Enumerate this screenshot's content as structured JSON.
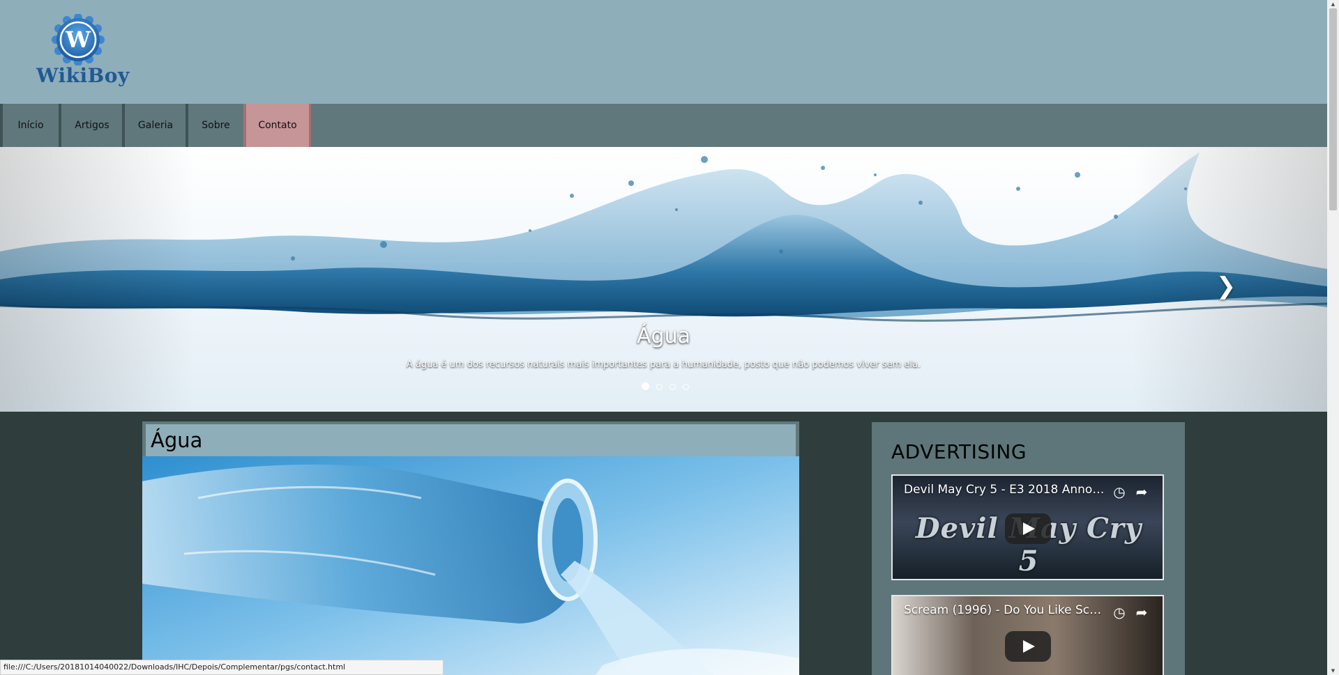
{
  "site": {
    "name": "WikiBoy",
    "logo_letter": "W"
  },
  "nav": {
    "items": [
      {
        "label": "Início"
      },
      {
        "label": "Artigos"
      },
      {
        "label": "Galeria"
      },
      {
        "label": "Sobre"
      },
      {
        "label": "Contato"
      }
    ],
    "active": "Contato"
  },
  "carousel": {
    "title": "Água",
    "text": "A água é um dos recursos naturais mais importantes para a humanidade, posto que não podemos viver sem ela.",
    "slides_count": 4,
    "active_slide": 1,
    "next_icon": "chevron-right-icon"
  },
  "article": {
    "title": "Água"
  },
  "sidebar": {
    "title": "ADVERTISING",
    "videos": [
      {
        "title": "Devil May Cry 5 - E3 2018 Announ...",
        "brand": "Devil May Cry 5"
      },
      {
        "title": "Scream (1996) - Do You Like Scary..."
      }
    ]
  },
  "status_bar": {
    "url": "file:///C:/Users/20181014040022/Downloads/IHC/Depois/Complementar/pgs/contact.html"
  },
  "colors": {
    "header_bg": "#8eaeba",
    "nav_bg": "#60787c",
    "nav_active_bg": "#c59597",
    "page_bg": "#2f3d3d",
    "panel_bg": "#5e7679",
    "logo_blue": "#1f5a96"
  }
}
